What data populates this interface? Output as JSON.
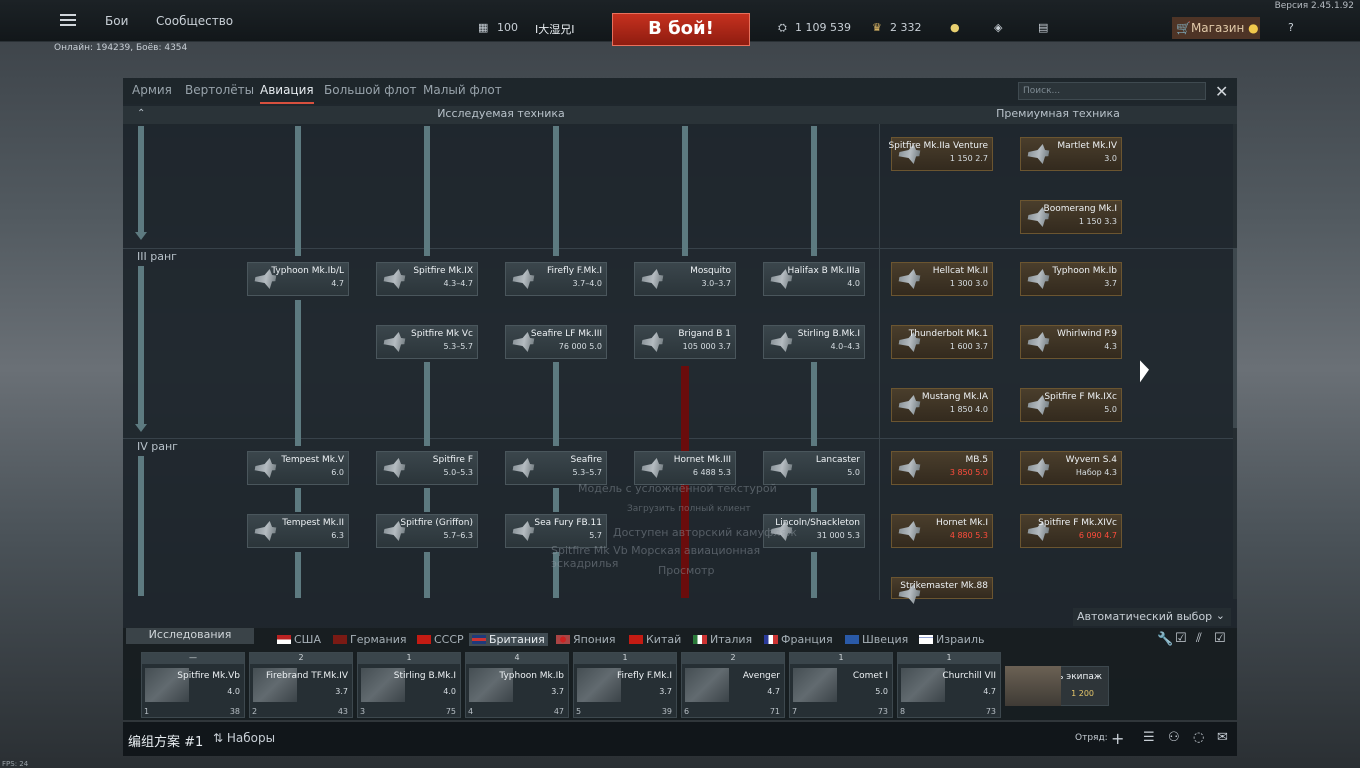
{
  "version": "Версия 2.45.1.92",
  "top_menu": {
    "battles": "Бои",
    "community": "Сообщество"
  },
  "player": {
    "level": "100",
    "name": "I大湿兄I"
  },
  "battle_button": "В бой!",
  "online": "Онлайн: 194239, Боёв: 4354",
  "currency": {
    "silver": "1 109 539",
    "gold": "2 332"
  },
  "shop": {
    "label": "Магазин"
  },
  "window_tabs": [
    "Армия",
    "Вертолёты",
    "Авиация",
    "Большой флот",
    "Малый флот"
  ],
  "search_placeholder": "Поиск...",
  "section_research": "Исследуемая техника",
  "section_premium": "Премиумная техника",
  "ranks": [
    "III ранг",
    "IV ранг"
  ],
  "research_cards": [
    {
      "name": "Typhoon Mk.Ib/L",
      "br": "4.7"
    },
    {
      "name": "Spitfire Mk.IX",
      "br": "4.3–4.7"
    },
    {
      "name": "Firefly F.Mk.I",
      "br": "3.7–4.0"
    },
    {
      "name": "Mosquito",
      "br": "3.0–3.7"
    },
    {
      "name": "Halifax B Mk.IIIa",
      "br": "4.0"
    },
    {
      "name": "Spitfire Mk Vc",
      "br": "5.3–5.7"
    },
    {
      "name": "Seafire LF Mk.III",
      "br": "76 000   5.0"
    },
    {
      "name": "Brigand B 1",
      "br": "105 000   3.7"
    },
    {
      "name": "Stirling B.Mk.I",
      "br": "4.0–4.3"
    },
    {
      "name": "Tempest Mk.V",
      "br": "6.0"
    },
    {
      "name": "Spitfire F",
      "br": "5.0–5.3"
    },
    {
      "name": "Seafire",
      "br": "5.3–5.7"
    },
    {
      "name": "Hornet Mk.III",
      "br": "6 488   5.3"
    },
    {
      "name": "Lancaster",
      "br": "5.0"
    },
    {
      "name": "Tempest Mk.II",
      "br": "6.3"
    },
    {
      "name": "Spitfire (Griffon)",
      "br": "5.7–6.3"
    },
    {
      "name": "Sea Fury FB.11",
      "br": "5.7"
    },
    {
      "name": "Lincoln/Shackleton",
      "br": "31 000   5.3"
    }
  ],
  "premium_cards": [
    {
      "name": "Spitfire Mk.IIa Venture",
      "br": "1 150   2.7"
    },
    {
      "name": "Martlet Mk.IV",
      "br": "3.0"
    },
    {
      "name": "Boomerang Mk.I",
      "br": "1 150   3.3"
    },
    {
      "name": "Hellcat Mk.II",
      "br": "1 300   3.0"
    },
    {
      "name": "Typhoon Mk.Ib",
      "br": "3.7"
    },
    {
      "name": "Thunderbolt Mk.1",
      "br": "1 600   3.7"
    },
    {
      "name": "Whirlwind P.9",
      "br": "4.3"
    },
    {
      "name": "Mustang Mk.IA",
      "br": "1 850   4.0"
    },
    {
      "name": "Spitfire F Mk.IXc",
      "br": "5.0"
    },
    {
      "name": "MB.5",
      "br": "3 850   5.0"
    },
    {
      "name": "Wyvern S.4",
      "br": "Набор 4.3"
    },
    {
      "name": "Hornet Mk.I",
      "br": "4 880   5.3"
    },
    {
      "name": "Spitfire F Mk.XIVc",
      "br": "6 090   4.7"
    },
    {
      "name": "Strikemaster Mk.88",
      "br": ""
    }
  ],
  "ghost_menu": [
    "Модель с усложнённой текстурой",
    "Загрузить полный клиент",
    "Доступен авторский камуфляж",
    "Spitfire Mk Vb Морская авиационная эскадрилья",
    "Просмотр"
  ],
  "auto_select": "Автоматический выбор",
  "research_tab": "Исследования",
  "nations": [
    "США",
    "Германия",
    "СССР",
    "Британия",
    "Япония",
    "Китай",
    "Италия",
    "Франция",
    "Швеция",
    "Израиль"
  ],
  "slots": [
    {
      "hdr": "—",
      "name": "Spitfire Mk.Vb",
      "br": "4.0",
      "num": "1",
      "foot": "38"
    },
    {
      "hdr": "2",
      "name": "Firebrand TF.Mk.IV",
      "br": "3.7",
      "num": "2",
      "foot": "43"
    },
    {
      "hdr": "1",
      "name": "Stirling B.Mk.I",
      "br": "4.0",
      "num": "3",
      "foot": "75"
    },
    {
      "hdr": "4",
      "name": "Typhoon Mk.Ib",
      "br": "3.7",
      "num": "4",
      "foot": "47"
    },
    {
      "hdr": "1",
      "name": "Firefly F.Mk.I",
      "br": "3.7",
      "num": "5",
      "foot": "39"
    },
    {
      "hdr": "2",
      "name": "Avenger",
      "br": "4.7",
      "num": "6",
      "foot": "71"
    },
    {
      "hdr": "1",
      "name": "Comet I",
      "br": "5.0",
      "num": "7",
      "foot": "73"
    },
    {
      "hdr": "1",
      "name": "Churchill VII",
      "br": "4.7",
      "num": "8",
      "foot": "73"
    }
  ],
  "crew": {
    "label": "Нанять экипаж",
    "cost": "1 200"
  },
  "preset": {
    "name": "编组方案 #1",
    "presets": "Наборы",
    "squad": "Отряд:"
  },
  "fps": "FPS: 24"
}
